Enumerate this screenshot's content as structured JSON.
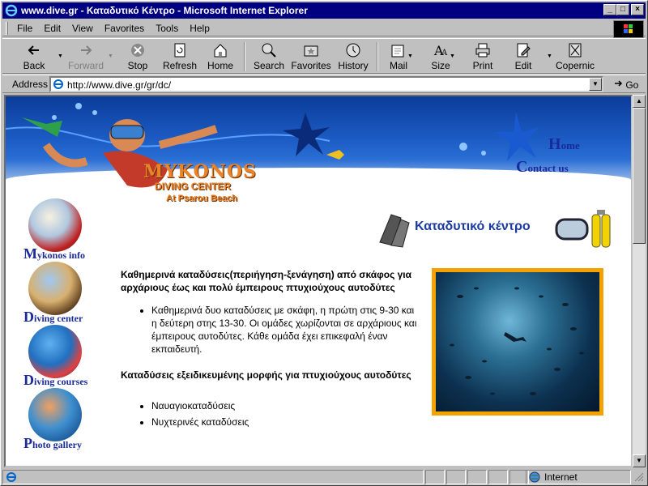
{
  "window": {
    "title": "www.dive.gr - Καταδυτικό Κέντρο - Microsoft Internet Explorer"
  },
  "menu": {
    "items": [
      "File",
      "Edit",
      "View",
      "Favorites",
      "Tools",
      "Help"
    ]
  },
  "toolbar": {
    "back": "Back",
    "forward": "Forward",
    "stop": "Stop",
    "refresh": "Refresh",
    "home": "Home",
    "search": "Search",
    "favorites": "Favorites",
    "history": "History",
    "mail": "Mail",
    "size": "Size",
    "print": "Print",
    "edit": "Edit",
    "copernic": "Copernic"
  },
  "address": {
    "label": "Address",
    "url": "http://www.dive.gr/gr/dc/",
    "go": "Go"
  },
  "page": {
    "logo_main": "MYKONOS",
    "logo_sub": "DIVING CENTER",
    "logo_sub2": "At Psarou Beach",
    "links": {
      "home_cap": "H",
      "home_rest": "ome",
      "contact_cap": "C",
      "contact_rest": "ontact us"
    },
    "section_title": "Καταδυτικό κέντρο",
    "nav": [
      {
        "cap": "M",
        "rest": "ykonos info"
      },
      {
        "cap": "D",
        "rest": "iving center"
      },
      {
        "cap": "D",
        "rest": "iving courses"
      },
      {
        "cap": "P",
        "rest": "hoto gallery"
      }
    ],
    "heading1": "Καθημερινά καταδύσεις(περιήγηση-ξενάγηση) από σκάφος για αρχάριους έως και πολύ έμπειρους πτυχιούχους αυτοδύτες",
    "bullet1": "Καθημερινά δυο καταδύσεις με σκάφη, η πρώτη στις 9-30 και η δεύτερη στης 13-30. Οι ομάδες χωρίζονται σε αρχάριους και έμπειρους αυτοδύτες. Κάθε ομάδα έχει επικεφαλή έναν εκπαιδευτή.",
    "heading2": "Καταδύσεις εξειδικευμένης μορφής για πτυχιούχους αυτοδύτες",
    "bullets2": [
      "Ναυαγιοκαταδύσεις",
      "Νυχτερινές καταδύσεις"
    ]
  },
  "status": {
    "zone": "Internet"
  },
  "colors": {
    "titlebar": "#000080",
    "link_blue": "#1a2a9a",
    "photo_frame": "#f4a200"
  }
}
